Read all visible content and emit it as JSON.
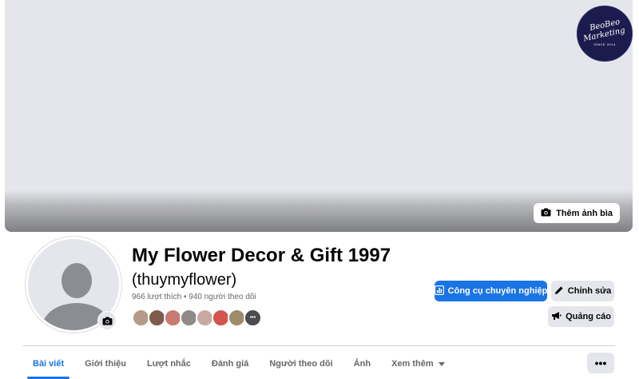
{
  "cover": {
    "add_cover_label": "Thêm ảnh bìa"
  },
  "logo": {
    "line1": "BeoBeo",
    "line2": "Marketing",
    "line3": "SINCE 2014"
  },
  "profile": {
    "name": "My Flower Decor & Gift 1997",
    "handle": "(thuymyflower)",
    "likes": "966 lượt thích",
    "separator": "•",
    "followers": "940 người theo dõi",
    "more_faces": "•••",
    "face_colors": [
      "#b59a88",
      "#7d5c4e",
      "#c97a73",
      "#8f8a86",
      "#c8a9a0",
      "#d2554f",
      "#9e8b6c",
      "#a7a49f"
    ]
  },
  "actions": {
    "pro_tools": "Công cụ chuyên nghiệp",
    "edit": "Chỉnh sửa",
    "ads": "Quảng cáo"
  },
  "tabs": [
    {
      "label": "Bài viết"
    },
    {
      "label": "Giới thiệu"
    },
    {
      "label": "Lượt nhắc"
    },
    {
      "label": "Đánh giá"
    },
    {
      "label": "Người theo dõi"
    },
    {
      "label": "Ảnh"
    },
    {
      "label": "Xem thêm"
    }
  ],
  "more_button_label": "•••",
  "colors": {
    "accent": "#1b74e4",
    "button_gray": "#e4e6eb",
    "text_secondary": "#65676b"
  }
}
